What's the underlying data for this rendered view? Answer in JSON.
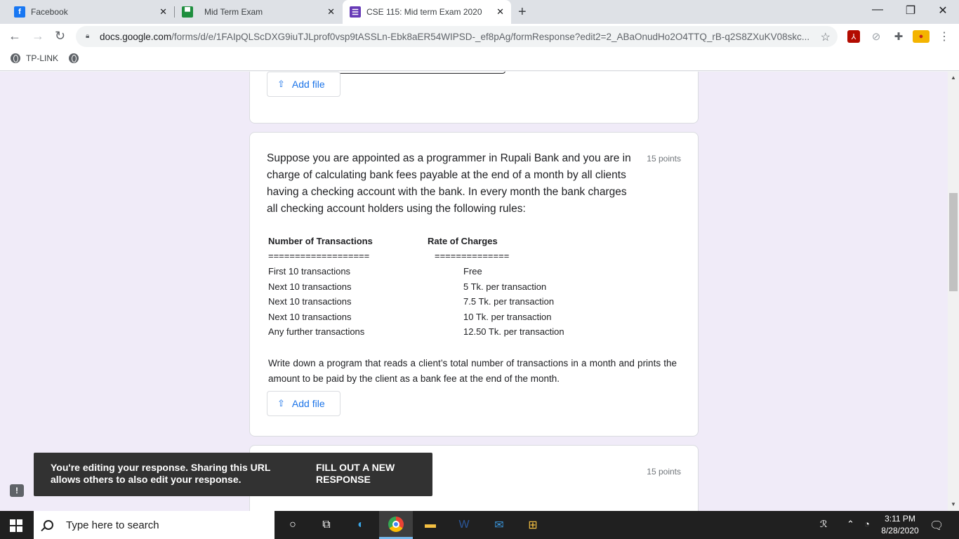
{
  "tabs": [
    {
      "title": "Facebook",
      "icon": "facebook-icon",
      "color": "#1877f2"
    },
    {
      "title": "Mid Term Exam",
      "icon": "classroom-icon",
      "color": "#1e8e3e"
    },
    {
      "title": "CSE 115: Mid term Exam 2020",
      "icon": "forms-icon",
      "color": "#673ab7"
    }
  ],
  "address": {
    "domain": "docs.google.com",
    "path": "/forms/d/e/1FAIpQLScDXG9iuTJLprof0vsp9tASSLn-Ebk8aER54WIPSD-_ef8pAg/formResponse?edit2=2_ABaOnudHo2O4TTQ_rB-q2S8ZXuKV08skc..."
  },
  "bookmarks": [
    {
      "label": "TP-LINK"
    }
  ],
  "form": {
    "add_file_label": "Add file",
    "question": {
      "points": "15 points",
      "text": "Suppose you are appointed as a programmer in Rupali Bank and you are in charge of calculating bank fees payable at the end of a month by all clients having a checking account with the bank. In every month the bank charges all checking account holders using the following rules:",
      "table": {
        "header_transactions": "Number of Transactions",
        "header_rate": "Rate of Charges",
        "underline_transactions": "===================",
        "underline_rate": "==============",
        "rows": [
          {
            "transactions": "First 10 transactions",
            "rate": "Free"
          },
          {
            "transactions": "Next 10 transactions",
            "rate": "5 Tk. per transaction"
          },
          {
            "transactions": "Next 10 transactions",
            "rate": "7.5 Tk. per transaction"
          },
          {
            "transactions": "Next 10 transactions",
            "rate": "10 Tk. per transaction"
          },
          {
            "transactions": "Any further transactions",
            "rate": "12.50 Tk. per transaction"
          }
        ]
      },
      "instruction": "Write down a program that reads a client’s total number of transactions in a month and prints the amount to be paid by the client as a bank fee at the end of the month."
    },
    "next_points": "15 points"
  },
  "toast": {
    "message": "You're editing your response. Sharing this URL allows others to also edit your response.",
    "action": "FILL OUT A NEW RESPONSE"
  },
  "taskbar": {
    "search_placeholder": "Type here to search",
    "time": "3:11 PM",
    "date": "8/28/2020"
  }
}
